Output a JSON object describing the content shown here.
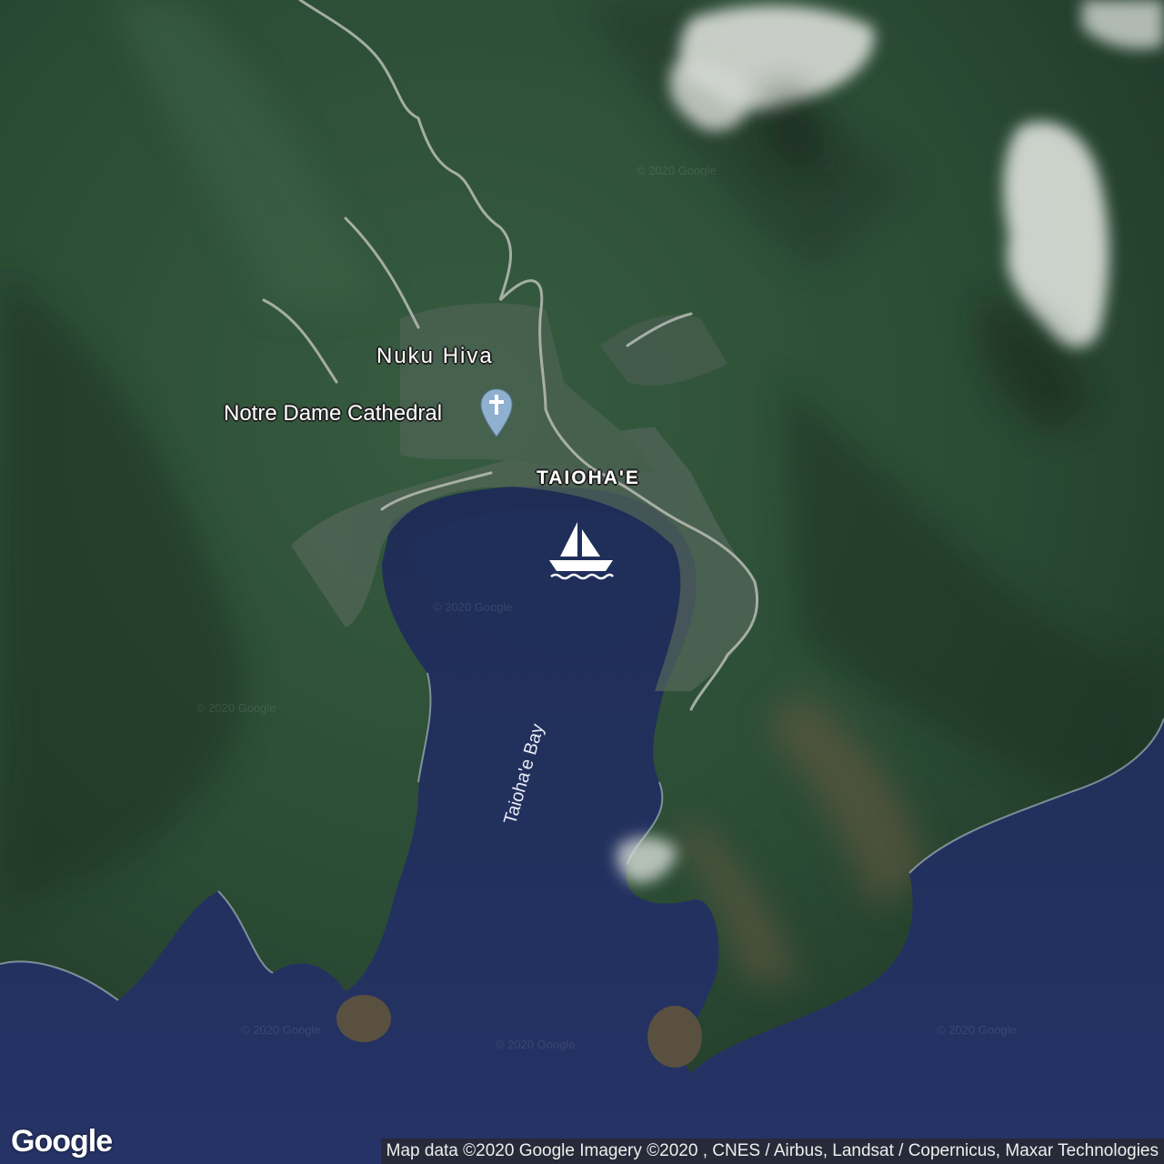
{
  "map": {
    "place_labels": {
      "island": "Nuku Hiva",
      "poi": "Notre Dame Cathedral",
      "town": "TAIOHA'E",
      "bay": "Taioha'e Bay"
    },
    "icons": {
      "poi": "church-pin-icon",
      "marina": "sailboat-icon"
    },
    "logo": "Google",
    "attribution": "Map data ©2020 Google  Imagery ©2020 , CNES / Airbus, Landsat / Copernicus, Maxar Technologies",
    "watermark": "© 2020 Google",
    "colors": {
      "land": "#2a4a34",
      "water": "#1c2a55",
      "cloud": "#d7dcd6",
      "pin": "#8fb0cf"
    }
  }
}
